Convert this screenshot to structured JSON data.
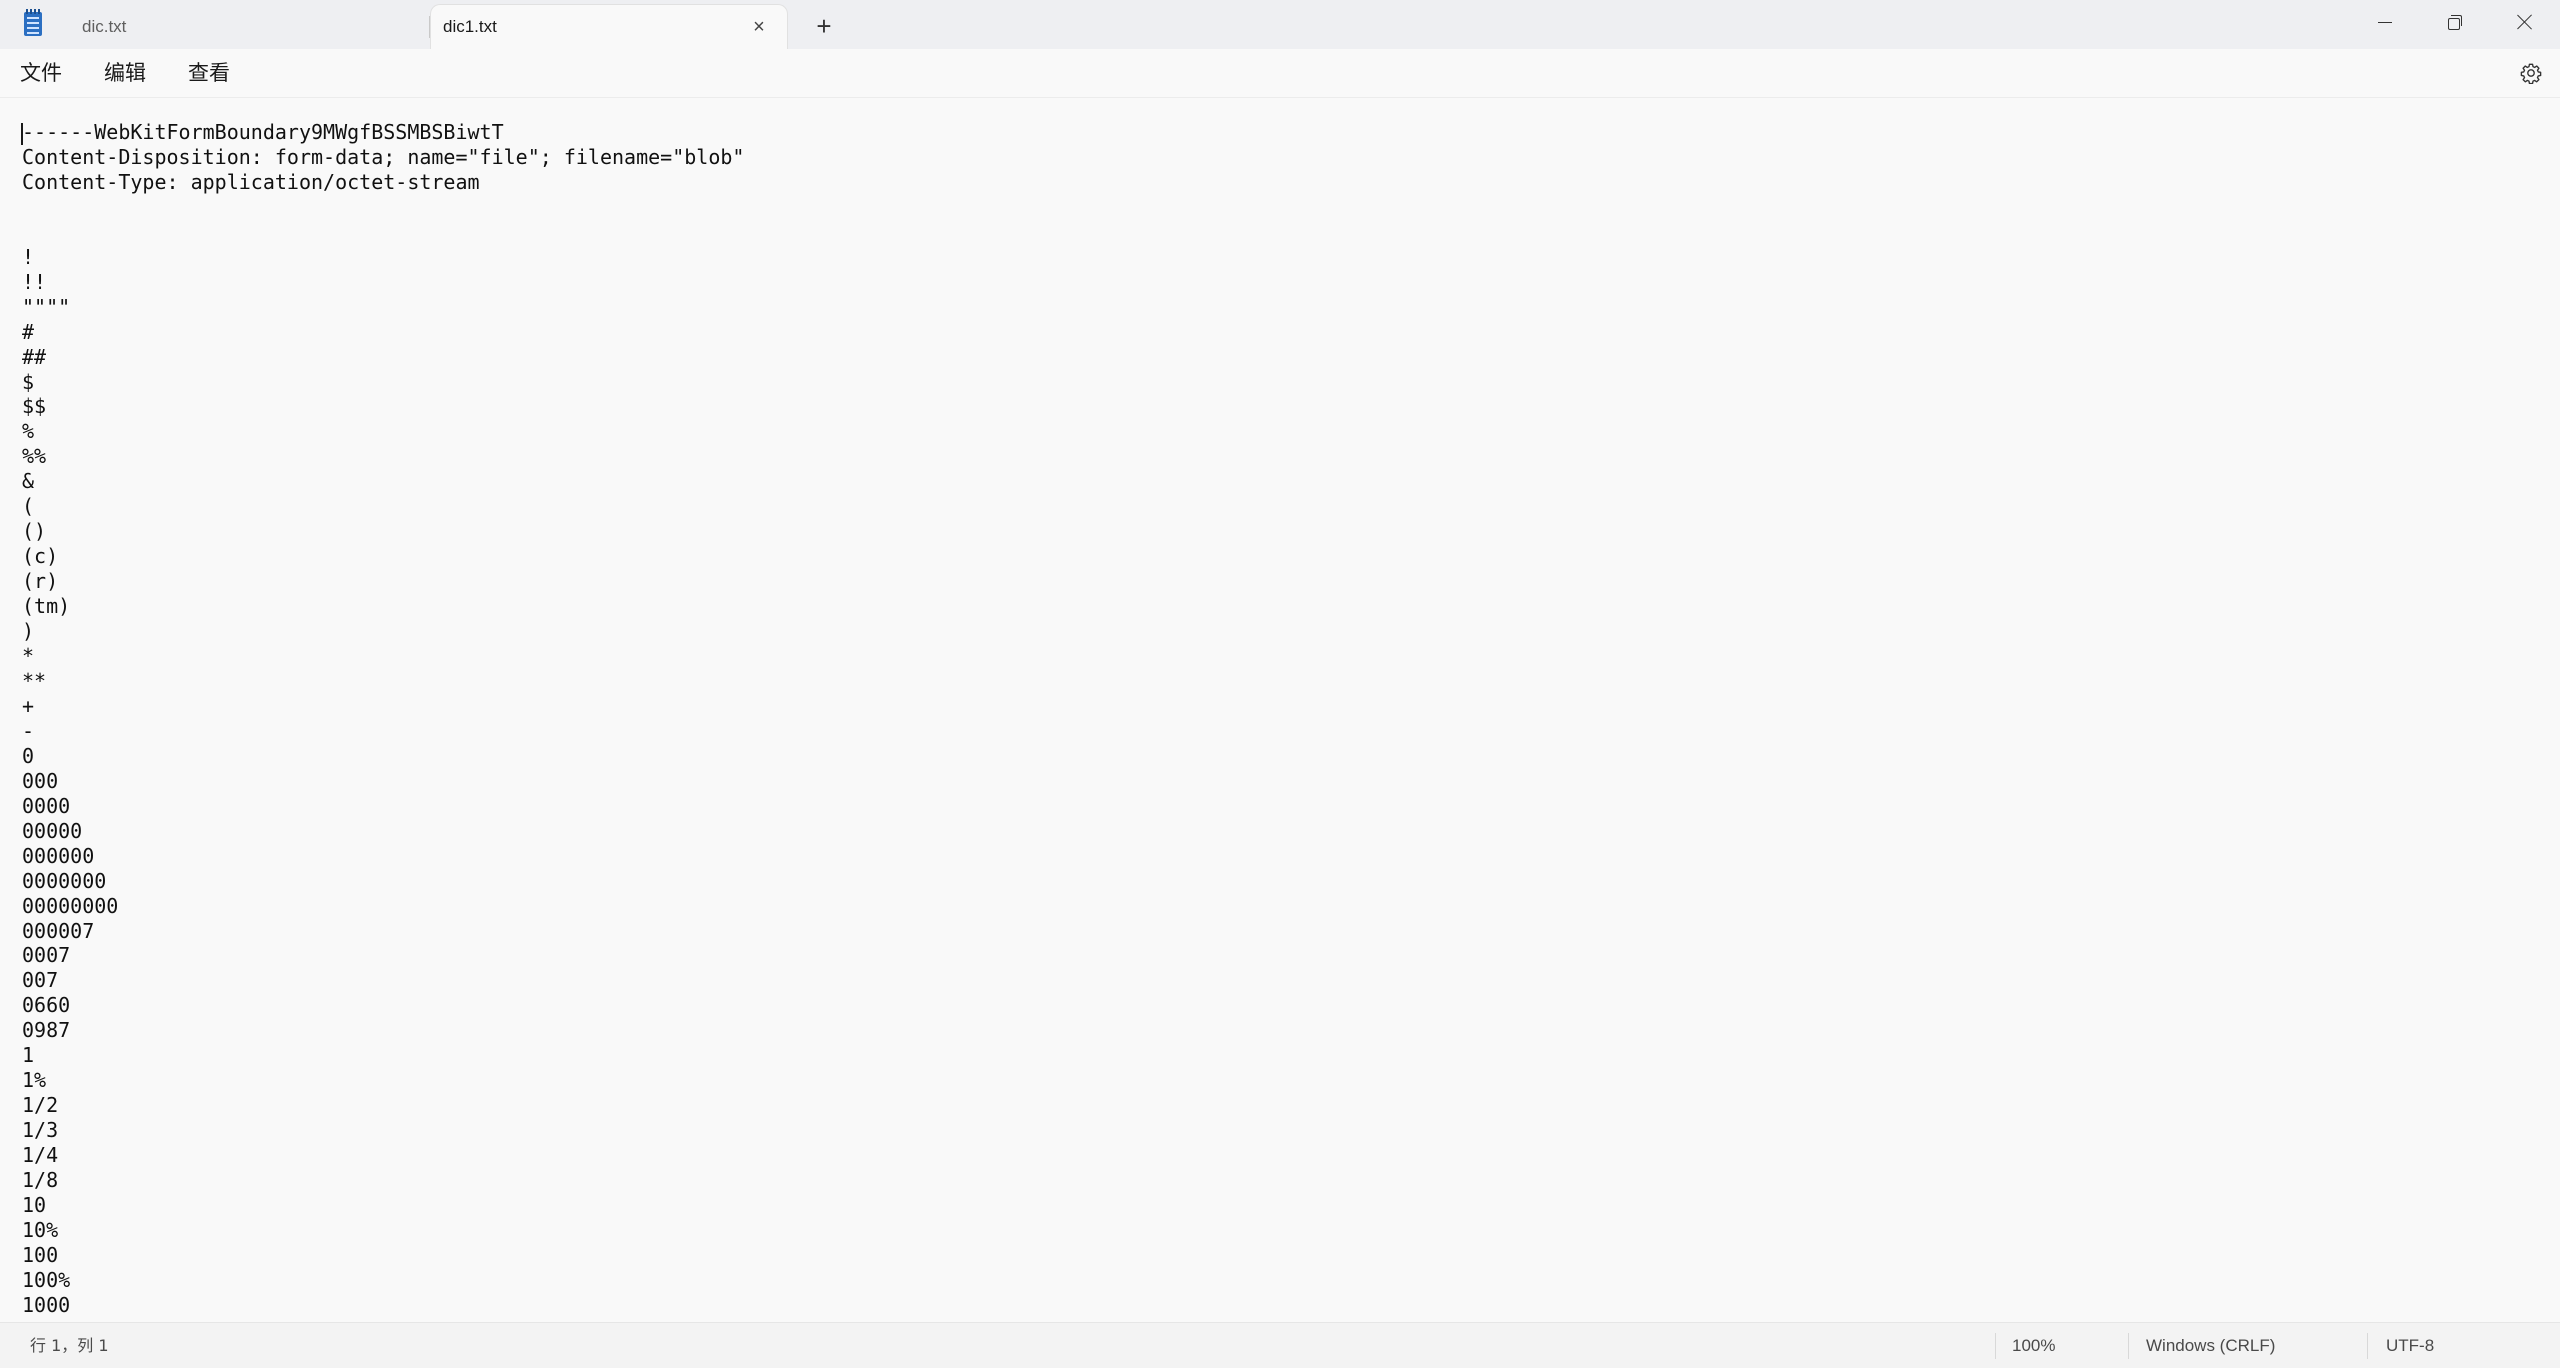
{
  "tabs": [
    {
      "label": "dic.txt",
      "active": false
    },
    {
      "label": "dic1.txt",
      "active": true
    }
  ],
  "menu": {
    "file": "文件",
    "edit": "编辑",
    "view": "查看"
  },
  "editor": {
    "lines": [
      "------WebKitFormBoundary9MWgfBSSMBSBiwtT",
      "Content-Disposition: form-data; name=\"file\"; filename=\"blob\"",
      "Content-Type: application/octet-stream",
      "",
      "",
      "!",
      "!!",
      "\"\"\"\"",
      "#",
      "##",
      "$",
      "$$",
      "%",
      "%%",
      "&",
      "(",
      "()",
      "(c)",
      "(r)",
      "(tm)",
      ")",
      "*",
      "**",
      "+",
      "-",
      "0",
      "000",
      "0000",
      "00000",
      "000000",
      "0000000",
      "00000000",
      "000007",
      "0007",
      "007",
      "0660",
      "0987",
      "1",
      "1%",
      "1/2",
      "1/3",
      "1/4",
      "1/8",
      "10",
      "10%",
      "100",
      "100%",
      "1000"
    ]
  },
  "status": {
    "position": "行 1，列 1",
    "zoom": "100%",
    "line_ending": "Windows (CRLF)",
    "encoding": "UTF-8"
  },
  "colors": {
    "titlebar_bg": "#eeeff2",
    "editor_bg": "#f9f9f9",
    "app_icon": "#2b6fc2"
  },
  "icons": {
    "app": "notepad-icon",
    "tab_close": "close-icon",
    "new_tab": "plus-icon",
    "settings": "gear-icon"
  }
}
